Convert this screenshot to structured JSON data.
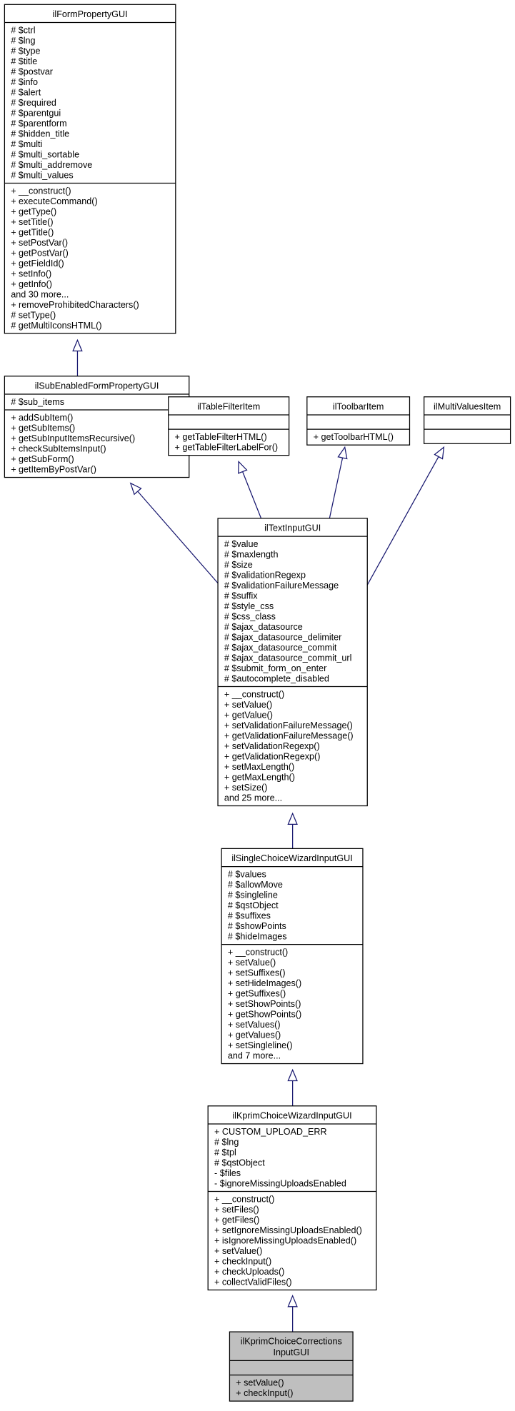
{
  "colors": {
    "edge": "#191970",
    "current_class_fill": "#bfbfbf",
    "box_fill": "#ffffff"
  },
  "classes": [
    {
      "id": "ilFormPropertyGUI",
      "title": [
        "ilFormPropertyGUI"
      ],
      "attributes": [
        "# $ctrl",
        "# $lng",
        "# $type",
        "# $title",
        "# $postvar",
        "# $info",
        "# $alert",
        "# $required",
        "# $parentgui",
        "# $parentform",
        "# $hidden_title",
        "# $multi",
        "# $multi_sortable",
        "# $multi_addremove",
        "# $multi_values"
      ],
      "methods": [
        "+ __construct()",
        "+ executeCommand()",
        "+ getType()",
        "+ setTitle()",
        "+ getTitle()",
        "+ setPostVar()",
        "+ getPostVar()",
        "+ getFieldId()",
        "+ setInfo()",
        "+ getInfo()",
        "and 30 more...",
        "+ removeProhibitedCharacters()",
        "# setType()",
        "# getMultiIconsHTML()"
      ]
    },
    {
      "id": "ilSubEnabledFormPropertyGUI",
      "title": [
        "ilSubEnabledFormPropertyGUI"
      ],
      "attributes": [
        "# $sub_items"
      ],
      "methods": [
        "+ addSubItem()",
        "+ getSubItems()",
        "+ getSubInputItemsRecursive()",
        "+ checkSubItemsInput()",
        "+ getSubForm()",
        "+ getItemByPostVar()"
      ]
    },
    {
      "id": "ilTableFilterItem",
      "title": [
        "ilTableFilterItem"
      ],
      "attributes": [],
      "methods": [
        "+ getTableFilterHTML()",
        "+ getTableFilterLabelFor()"
      ]
    },
    {
      "id": "ilToolbarItem",
      "title": [
        "ilToolbarItem"
      ],
      "attributes": [],
      "methods": [
        "+ getToolbarHTML()"
      ]
    },
    {
      "id": "ilMultiValuesItem",
      "title": [
        "ilMultiValuesItem"
      ],
      "attributes": [],
      "methods": []
    },
    {
      "id": "ilTextInputGUI",
      "title": [
        "ilTextInputGUI"
      ],
      "attributes": [
        "# $value",
        "# $maxlength",
        "# $size",
        "# $validationRegexp",
        "# $validationFailureMessage",
        "# $suffix",
        "# $style_css",
        "# $css_class",
        "# $ajax_datasource",
        "# $ajax_datasource_delimiter",
        "# $ajax_datasource_commit",
        "# $ajax_datasource_commit_url",
        "# $submit_form_on_enter",
        "# $autocomplete_disabled"
      ],
      "methods": [
        "+ __construct()",
        "+ setValue()",
        "+ getValue()",
        "+ setValidationFailureMessage()",
        "+ getValidationFailureMessage()",
        "+ setValidationRegexp()",
        "+ getValidationRegexp()",
        "+ setMaxLength()",
        "+ getMaxLength()",
        "+ setSize()",
        "and 25 more..."
      ]
    },
    {
      "id": "ilSingleChoiceWizardInputGUI",
      "title": [
        "ilSingleChoiceWizardInputGUI"
      ],
      "attributes": [
        "# $values",
        "# $allowMove",
        "# $singleline",
        "# $qstObject",
        "# $suffixes",
        "# $showPoints",
        "# $hideImages"
      ],
      "methods": [
        "+ __construct()",
        "+ setValue()",
        "+ setSuffixes()",
        "+ setHideImages()",
        "+ getSuffixes()",
        "+ setShowPoints()",
        "+ getShowPoints()",
        "+ setValues()",
        "+ getValues()",
        "+ setSingleline()",
        "and 7 more..."
      ]
    },
    {
      "id": "ilKprimChoiceWizardInputGUI",
      "title": [
        "ilKprimChoiceWizardInputGUI"
      ],
      "attributes": [
        "+ CUSTOM_UPLOAD_ERR",
        "# $lng",
        "# $tpl",
        "# $qstObject",
        "- $files",
        "- $ignoreMissingUploadsEnabled"
      ],
      "methods": [
        "+ __construct()",
        "+ setFiles()",
        "+ getFiles()",
        "+ setIgnoreMissingUploadsEnabled()",
        "+ isIgnoreMissingUploadsEnabled()",
        "+ setValue()",
        "+ checkInput()",
        "+ checkUploads()",
        "+ collectValidFiles()"
      ]
    },
    {
      "id": "ilKprimChoiceCorrectionsInputGUI",
      "title": [
        "ilKprimChoiceCorrections",
        "InputGUI"
      ],
      "current": true,
      "attributes": [],
      "methods": [
        "+ setValue()",
        "+ checkInput()"
      ]
    }
  ],
  "inheritance": [
    {
      "child": "ilSubEnabledFormPropertyGUI",
      "parent": "ilFormPropertyGUI"
    },
    {
      "child": "ilTextInputGUI",
      "parent": "ilSubEnabledFormPropertyGUI"
    },
    {
      "child": "ilTextInputGUI",
      "parent": "ilTableFilterItem"
    },
    {
      "child": "ilTextInputGUI",
      "parent": "ilToolbarItem"
    },
    {
      "child": "ilTextInputGUI",
      "parent": "ilMultiValuesItem"
    },
    {
      "child": "ilSingleChoiceWizardInputGUI",
      "parent": "ilTextInputGUI"
    },
    {
      "child": "ilKprimChoiceWizardInputGUI",
      "parent": "ilSingleChoiceWizardInputGUI"
    },
    {
      "child": "ilKprimChoiceCorrectionsInputGUI",
      "parent": "ilKprimChoiceWizardInputGUI"
    }
  ]
}
